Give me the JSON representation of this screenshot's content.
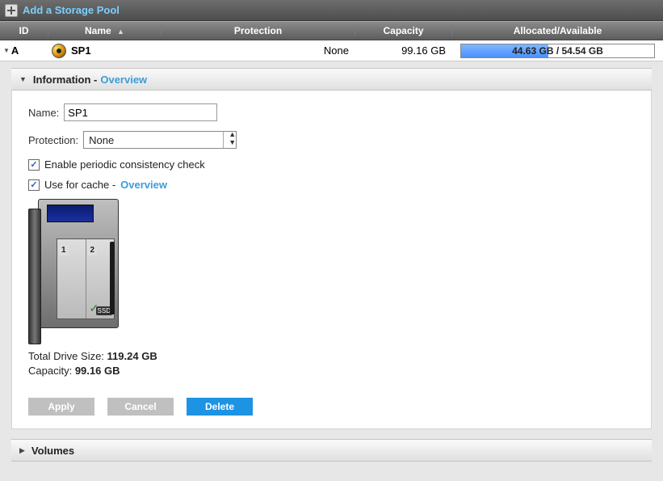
{
  "topbar": {
    "add_label": "Add a Storage Pool"
  },
  "table": {
    "headers": {
      "id": "ID",
      "name": "Name",
      "protection": "Protection",
      "capacity": "Capacity",
      "alloc": "Allocated/Available"
    },
    "row": {
      "id": "A",
      "name": "SP1",
      "protection": "None",
      "capacity": "99.16 GB",
      "alloc_text": "44.63 GB / 54.54 GB"
    }
  },
  "info": {
    "section_label": "Information -",
    "overview_link": "Overview",
    "name_label": "Name:",
    "name_value": "SP1",
    "protection_label": "Protection:",
    "protection_value": "None",
    "chk_consistency": "Enable periodic consistency check",
    "chk_cache": "Use for cache -",
    "cache_link": "Overview",
    "bay1": "1",
    "bay2": "2",
    "ssd": "SSD",
    "total_label": "Total Drive Size:",
    "total_value": "119.24 GB",
    "cap_label": "Capacity:",
    "cap_value": "99.16 GB",
    "apply": "Apply",
    "cancel": "Cancel",
    "delete": "Delete"
  },
  "volumes": {
    "label": "Volumes"
  }
}
